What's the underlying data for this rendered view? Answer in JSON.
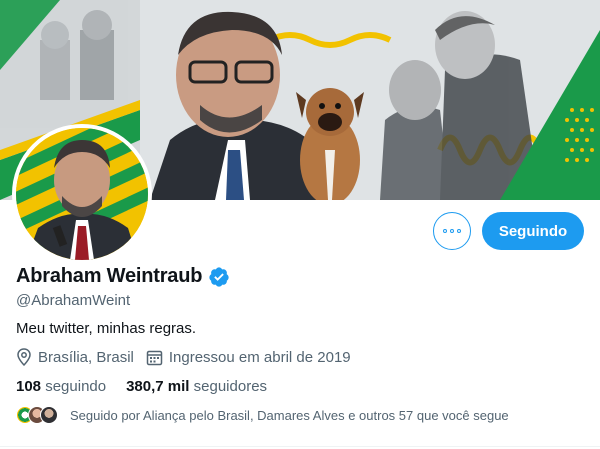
{
  "profile": {
    "display_name": "Abraham Weintraub",
    "handle": "@AbrahamWeint",
    "bio": "Meu twitter, minhas regras.",
    "location": "Brasília, Brasil",
    "joined": "Ingressou em abril de 2019",
    "verified": true
  },
  "actions": {
    "follow_label": "Seguindo",
    "more_icon": "more-icon"
  },
  "stats": {
    "following_count": "108",
    "following_label": "seguindo",
    "followers_count": "380,7 mil",
    "followers_label": "seguidores"
  },
  "followed_by": {
    "text": "Seguido por Aliança pelo Brasil, Damares Alves e outros 57 que você segue"
  },
  "icons": {
    "location": "location-pin-icon",
    "calendar": "calendar-icon",
    "verified": "verified-badge-icon"
  },
  "colors": {
    "accent": "#1d9bf0",
    "text_primary": "#0f1419",
    "text_secondary": "#536471",
    "banner_green": "#1a9a4a",
    "banner_yellow": "#f2c200"
  }
}
